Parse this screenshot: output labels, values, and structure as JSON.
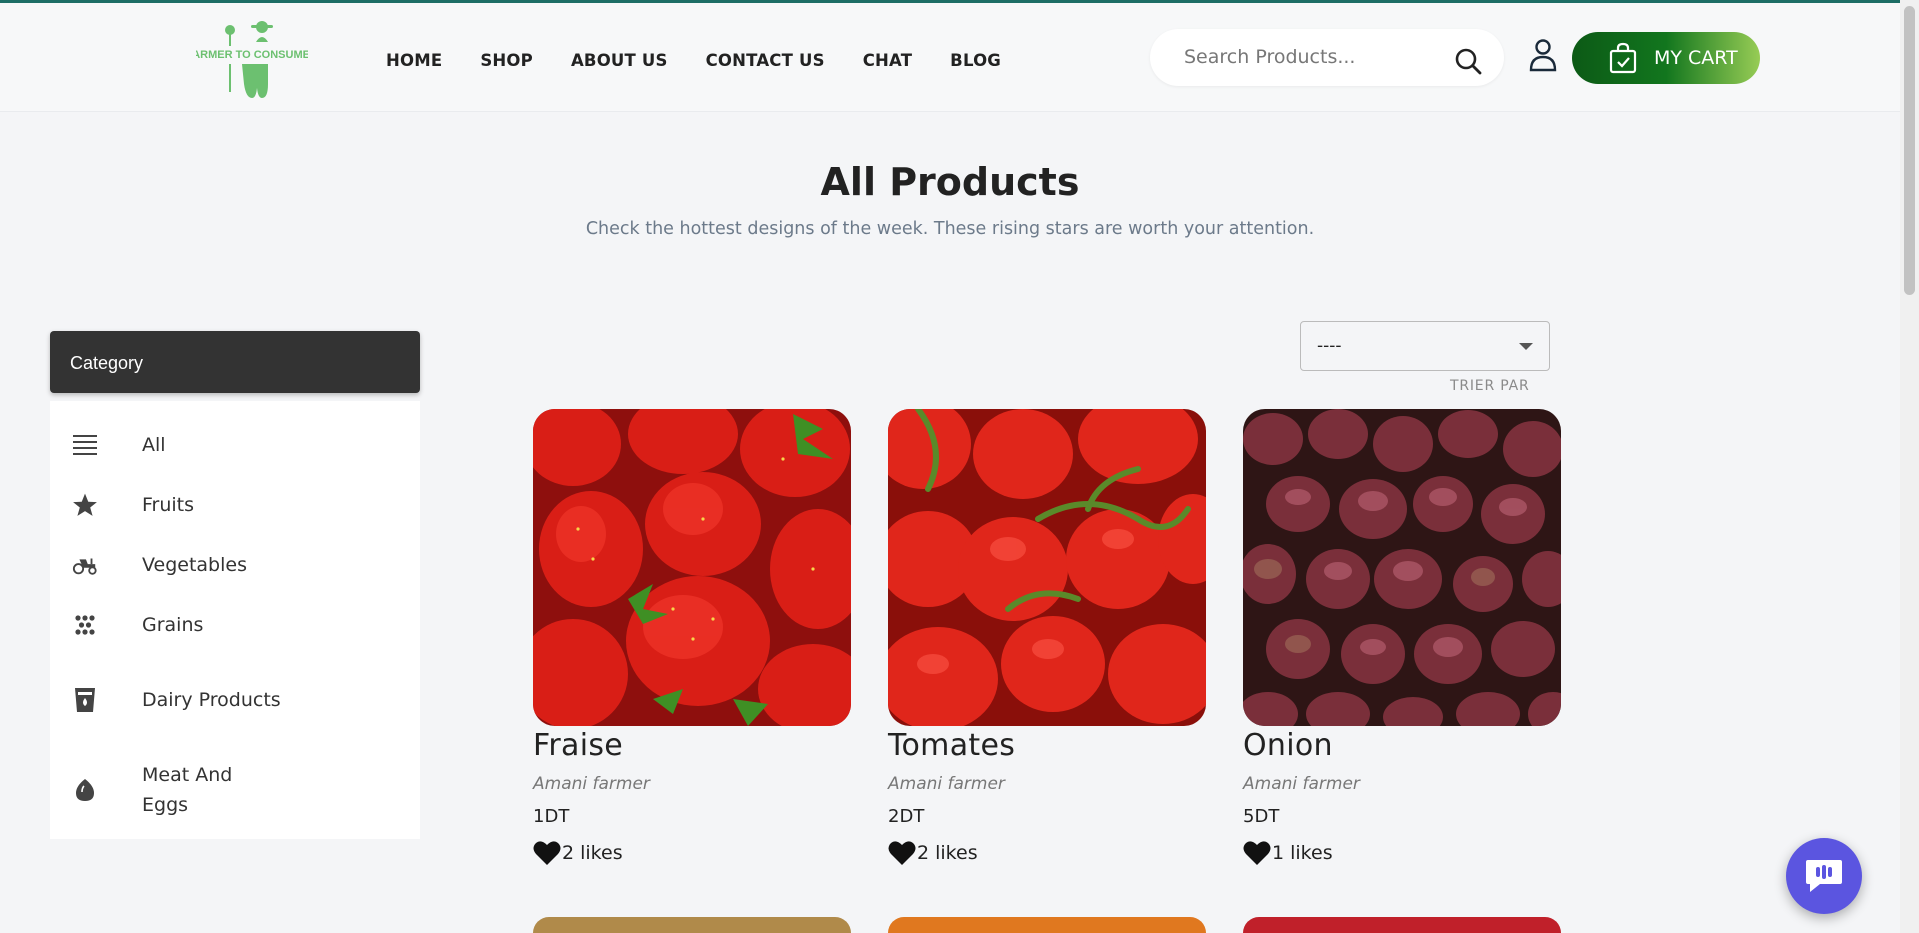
{
  "header": {
    "logo_text": "FARMER TO CONSUMER",
    "nav": [
      "HOME",
      "SHOP",
      "ABOUT US",
      "CONTACT US",
      "CHAT",
      "BLOG"
    ],
    "search_placeholder": "Search Products...",
    "cart_label": "MY CART",
    "brand_color": "#12761e"
  },
  "main": {
    "title": "All Products",
    "subtitle": "Check the hottest designs of the week. These rising stars are worth your attention."
  },
  "sidebar": {
    "heading": "Category",
    "items": [
      {
        "label": "All",
        "icon": "list-icon"
      },
      {
        "label": "Fruits",
        "icon": "star-icon"
      },
      {
        "label": "Vegetables",
        "icon": "tractor-icon"
      },
      {
        "label": "Grains",
        "icon": "grains-icon"
      },
      {
        "label": "Dairy Products",
        "icon": "milk-glass-icon"
      },
      {
        "label": "Meat And Eggs",
        "icon": "egg-icon"
      }
    ]
  },
  "sort": {
    "value": "----",
    "label": "TRIER PAR"
  },
  "products": [
    {
      "name": "Fraise",
      "farmer": "Amani farmer",
      "price": "1DT",
      "likes": "2 likes",
      "image": "strawberries"
    },
    {
      "name": "Tomates",
      "farmer": "Amani farmer",
      "price": "2DT",
      "likes": "2 likes",
      "image": "tomatoes"
    },
    {
      "name": "Onion",
      "farmer": "Amani farmer",
      "price": "5DT",
      "likes": "1 likes",
      "image": "red-onions"
    }
  ]
}
